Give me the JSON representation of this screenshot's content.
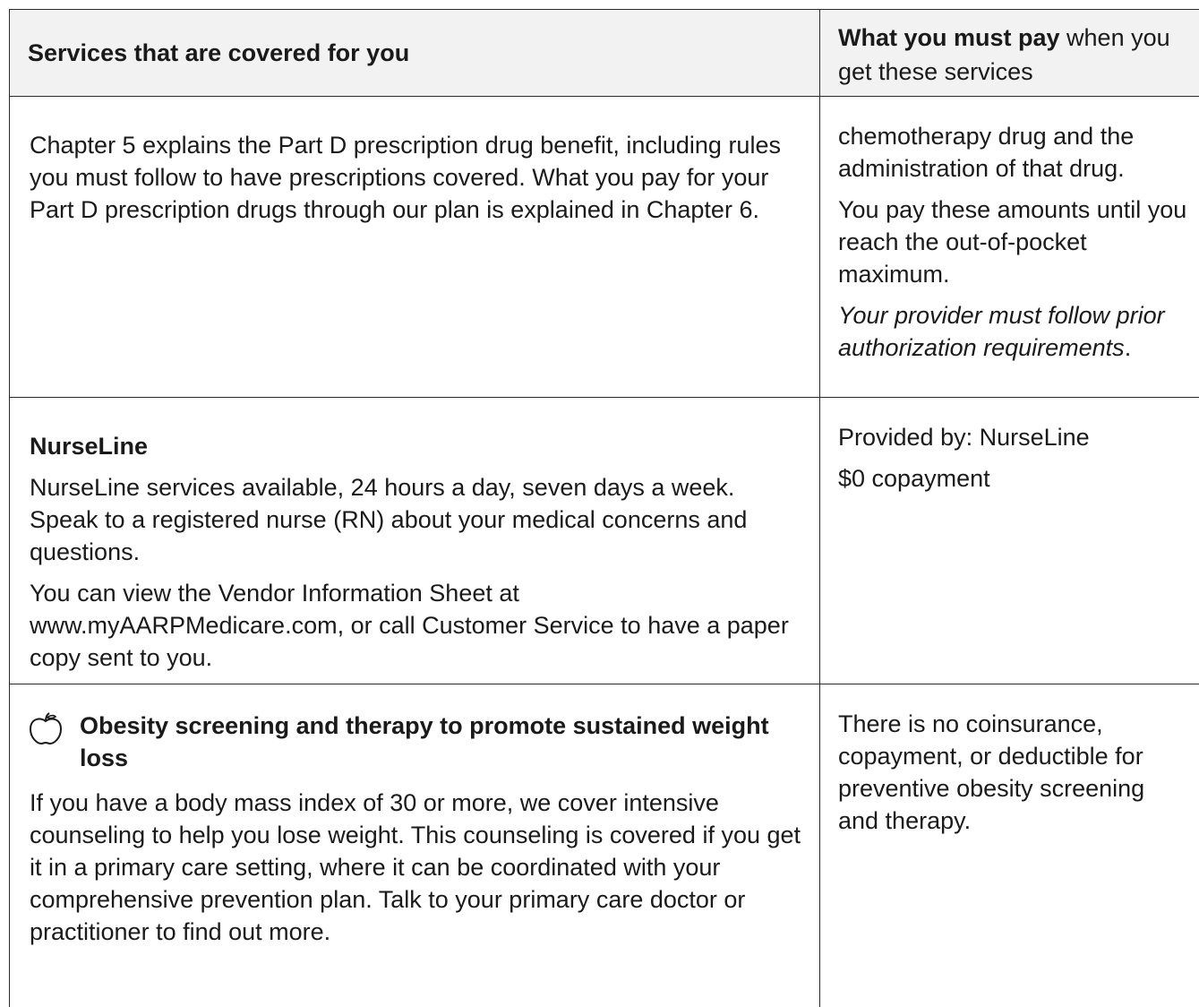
{
  "header": {
    "left": "Services that are covered for you",
    "right_bold": "What you must pay",
    "right_rest": " when you get these services"
  },
  "rows": [
    {
      "left": [
        "Chapter 5 explains the Part D prescription drug benefit, including rules you must follow to have prescriptions covered. What you pay for your Part D prescription drugs through our plan is explained in Chapter 6."
      ],
      "right": [
        "chemotherapy drug and the administration of that drug.",
        "You pay these amounts until you reach the out-of-pocket maximum."
      ],
      "right_italic": "Your provider must follow prior authorization requirements",
      "right_italic_end": "."
    },
    {
      "title": "NurseLine",
      "left": [
        "NurseLine services available, 24 hours a day, seven days a week. Speak to a registered nurse (RN) about your medical concerns and questions.",
        "You can view the Vendor Information Sheet at www.myAARPMedicare.com, or call Customer Service to have a paper copy sent to you."
      ],
      "right": [
        "Provided by: NurseLine",
        "$0 copayment"
      ]
    },
    {
      "icon": "apple-icon",
      "title": "Obesity screening and therapy to promote sustained weight loss",
      "left": [
        "If you have a body mass index of 30 or more, we cover intensive counseling to help you lose weight. This counseling is covered if you get it in a primary care setting, where it can be coordinated with your comprehensive prevention plan. Talk to your primary care doctor or practitioner to find out more."
      ],
      "right": [
        "There is no coinsurance, copayment, or deductible for preventive obesity screening and therapy."
      ]
    }
  ]
}
